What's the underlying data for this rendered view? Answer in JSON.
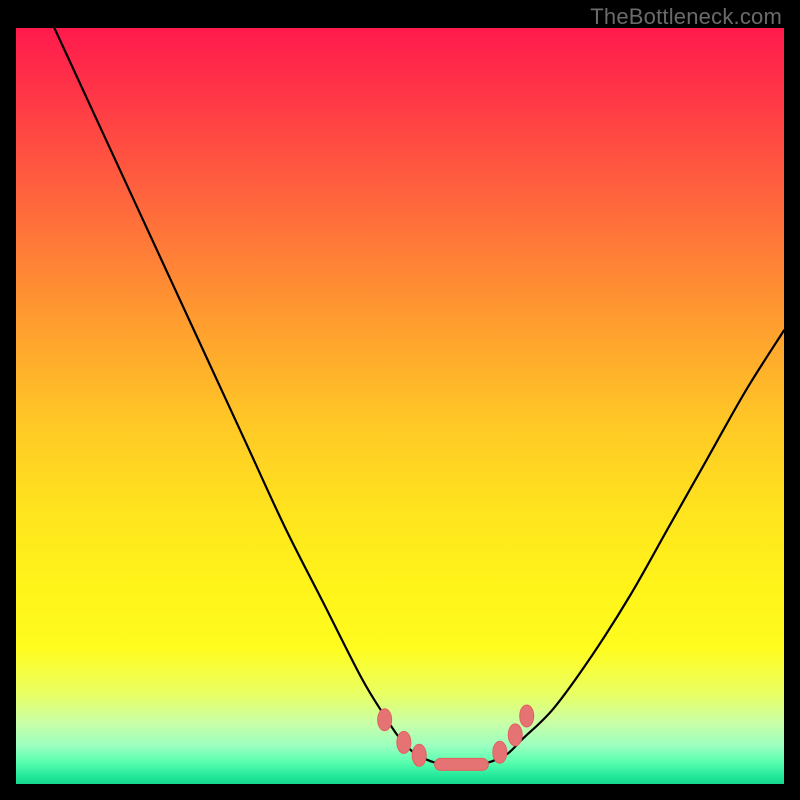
{
  "watermark": "TheBottleneck.com",
  "chart_data": {
    "type": "line",
    "title": "",
    "xlabel": "",
    "ylabel": "",
    "xlim": [
      0,
      100
    ],
    "ylim": [
      0,
      100
    ],
    "grid": false,
    "legend": false,
    "background_gradient": {
      "orientation": "vertical",
      "stops": [
        {
          "pos": 0.0,
          "color": "#ff1a4d"
        },
        {
          "pos": 0.5,
          "color": "#ffc726"
        },
        {
          "pos": 0.8,
          "color": "#fffc1e"
        },
        {
          "pos": 1.0,
          "color": "#16d890"
        }
      ]
    },
    "series": [
      {
        "name": "left-arm",
        "x": [
          5,
          10,
          15,
          20,
          25,
          30,
          35,
          40,
          45,
          48,
          50,
          52,
          54
        ],
        "y": [
          100,
          89,
          78,
          67,
          56,
          45,
          34,
          24,
          14,
          9,
          6,
          4,
          3
        ]
      },
      {
        "name": "right-arm",
        "x": [
          62,
          64,
          66,
          70,
          75,
          80,
          85,
          90,
          95,
          100
        ],
        "y": [
          3,
          4,
          6,
          10,
          17,
          25,
          34,
          43,
          52,
          60
        ]
      },
      {
        "name": "valley-floor",
        "x": [
          54,
          56,
          58,
          60,
          62
        ],
        "y": [
          3,
          2.5,
          2.5,
          2.5,
          3
        ]
      }
    ],
    "markers": [
      {
        "x": 48.0,
        "y": 8.5
      },
      {
        "x": 50.5,
        "y": 5.5
      },
      {
        "x": 52.5,
        "y": 3.8
      },
      {
        "x": 63.0,
        "y": 4.2
      },
      {
        "x": 65.0,
        "y": 6.5
      },
      {
        "x": 66.5,
        "y": 9.0
      }
    ],
    "valley_bar": {
      "x0": 54.5,
      "x1": 61.5,
      "y": 2.6
    }
  }
}
